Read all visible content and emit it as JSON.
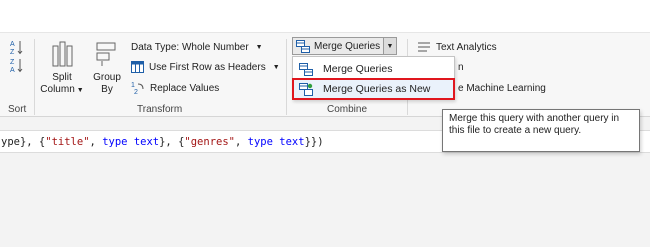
{
  "ribbon": {
    "sort": {
      "label": "Sort"
    },
    "transform": {
      "label": "Transform",
      "split_column": {
        "line1": "Split",
        "line2": "Column"
      },
      "group_by": {
        "line1": "Group",
        "line2": "By"
      },
      "data_type": "Data Type: Whole Number",
      "first_row_headers": "Use First Row as Headers",
      "replace_values": "Replace Values"
    },
    "combine": {
      "label": "Combine",
      "merge_queries": "Merge Queries"
    },
    "ai": {
      "text_analytics": "Text Analytics",
      "vision_partial": "n",
      "machine_learning_partial": "e Machine Learning"
    }
  },
  "menu": {
    "items": [
      {
        "label": "Merge Queries"
      },
      {
        "label": "Merge Queries as New"
      }
    ]
  },
  "tooltip": {
    "text": "Merge this query with another query in this file to create a new query."
  },
  "formula": {
    "p1": "ype}, {",
    "s1": "\"title\"",
    "p2": ", ",
    "k1": "type",
    "p3": " ",
    "k2": "text",
    "p4": "}, {",
    "s2": "\"genres\"",
    "p5": ", ",
    "k3": "type",
    "p6": " ",
    "k4": "text",
    "p7": "}})"
  },
  "colors": {
    "highlight_border": "#e0161e",
    "keyword": "#0000ff",
    "string": "#a31515"
  }
}
